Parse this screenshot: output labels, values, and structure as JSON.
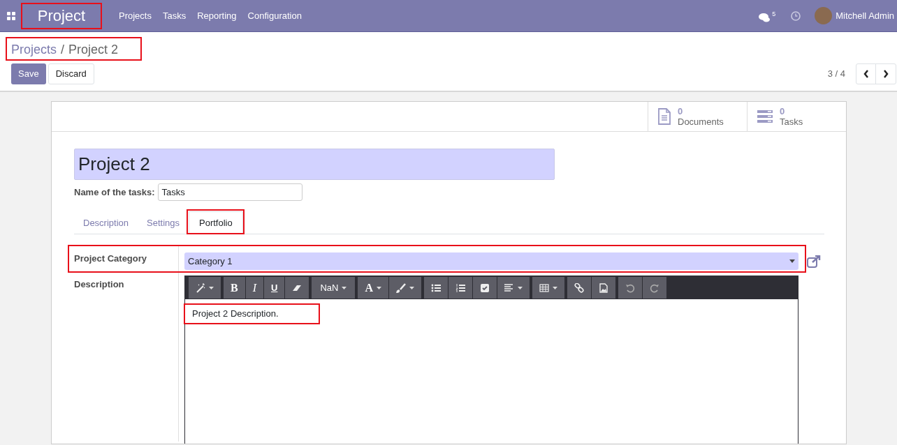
{
  "navbar": {
    "app_name": "Project",
    "menu": [
      "Projects",
      "Tasks",
      "Reporting",
      "Configuration"
    ],
    "messages_count": "5",
    "user_name": "Mitchell Admin"
  },
  "breadcrumb": {
    "parent": "Projects",
    "separator": "/",
    "current": "Project 2"
  },
  "actions": [
    "Save",
    "Discard"
  ],
  "pager": {
    "text": "3 / 4"
  },
  "stat_buttons": [
    {
      "kind": "documents",
      "count": "0",
      "label": "Documents"
    },
    {
      "kind": "tasks",
      "count": "0",
      "label": "Tasks"
    }
  ],
  "title": "Project 2",
  "name_of_tasks": {
    "label": "Name of the tasks:",
    "value": "Tasks"
  },
  "tabs": [
    {
      "label": "Description",
      "selected": false
    },
    {
      "label": "Settings",
      "selected": false
    },
    {
      "label": "Portfolio",
      "selected": true
    }
  ],
  "project_category": {
    "label": "Project Category",
    "value": "Category 1"
  },
  "description": {
    "label": "Description",
    "toolbar": {
      "bold": "B",
      "italic": "I",
      "underline": "U",
      "font_size": "NaN",
      "font_color": "A"
    },
    "content": "Project 2 Description."
  }
}
